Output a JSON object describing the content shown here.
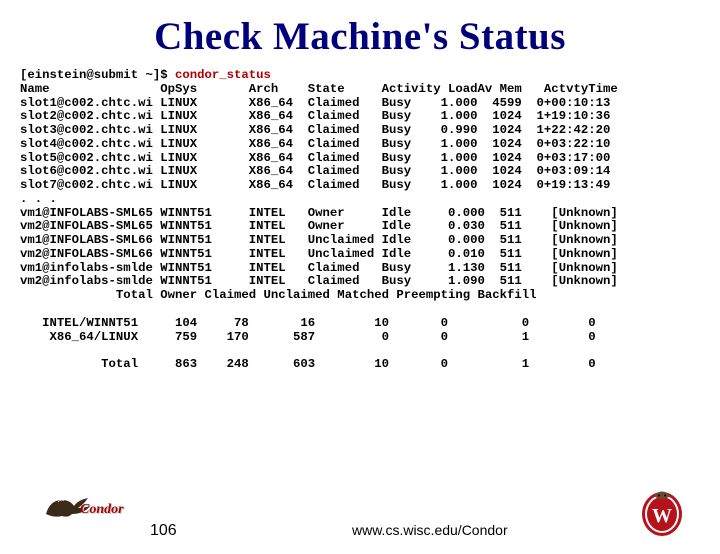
{
  "title": "Check Machine's Status",
  "prompt": "[einstein@submit ~]$ ",
  "command": "condor_status",
  "headers": {
    "name": "Name",
    "opsys": "OpSys",
    "arch": "Arch",
    "state": "State",
    "activity": "Activity",
    "loadav": "LoadAv",
    "mem": "Mem",
    "actvtytime": "ActvtyTime"
  },
  "rows1": [
    {
      "name": "slot1@c002.chtc.wi",
      "op": "LINUX",
      "arch": "X86_64",
      "state": "Claimed",
      "act": "Busy",
      "load": "1.000",
      "mem": "4599",
      "time": "0+00:10:13"
    },
    {
      "name": "slot2@c002.chtc.wi",
      "op": "LINUX",
      "arch": "X86_64",
      "state": "Claimed",
      "act": "Busy",
      "load": "1.000",
      "mem": "1024",
      "time": "1+19:10:36"
    },
    {
      "name": "slot3@c002.chtc.wi",
      "op": "LINUX",
      "arch": "X86_64",
      "state": "Claimed",
      "act": "Busy",
      "load": "0.990",
      "mem": "1024",
      "time": "1+22:42:20"
    },
    {
      "name": "slot4@c002.chtc.wi",
      "op": "LINUX",
      "arch": "X86_64",
      "state": "Claimed",
      "act": "Busy",
      "load": "1.000",
      "mem": "1024",
      "time": "0+03:22:10"
    },
    {
      "name": "slot5@c002.chtc.wi",
      "op": "LINUX",
      "arch": "X86_64",
      "state": "Claimed",
      "act": "Busy",
      "load": "1.000",
      "mem": "1024",
      "time": "0+03:17:00"
    },
    {
      "name": "slot6@c002.chtc.wi",
      "op": "LINUX",
      "arch": "X86_64",
      "state": "Claimed",
      "act": "Busy",
      "load": "1.000",
      "mem": "1024",
      "time": "0+03:09:14"
    },
    {
      "name": "slot7@c002.chtc.wi",
      "op": "LINUX",
      "arch": "X86_64",
      "state": "Claimed",
      "act": "Busy",
      "load": "1.000",
      "mem": "1024",
      "time": "0+19:13:49"
    }
  ],
  "ellipsis": ". . .",
  "rows2": [
    {
      "name": "vm1@INFOLABS-SML65",
      "op": "WINNT51",
      "arch": "INTEL",
      "state": "Owner",
      "act": "Idle",
      "load": "0.000",
      "mem": "511",
      "time": "[Unknown]"
    },
    {
      "name": "vm2@INFOLABS-SML65",
      "op": "WINNT51",
      "arch": "INTEL",
      "state": "Owner",
      "act": "Idle",
      "load": "0.030",
      "mem": "511",
      "time": "[Unknown]"
    },
    {
      "name": "vm1@INFOLABS-SML66",
      "op": "WINNT51",
      "arch": "INTEL",
      "state": "Unclaimed",
      "act": "Idle",
      "load": "0.000",
      "mem": "511",
      "time": "[Unknown]"
    },
    {
      "name": "vm2@INFOLABS-SML66",
      "op": "WINNT51",
      "arch": "INTEL",
      "state": "Unclaimed",
      "act": "Idle",
      "load": "0.010",
      "mem": "511",
      "time": "[Unknown]"
    },
    {
      "name": "vm1@infolabs-smlde",
      "op": "WINNT51",
      "arch": "INTEL",
      "state": "Claimed",
      "act": "Busy",
      "load": "1.130",
      "mem": "511",
      "time": "[Unknown]"
    },
    {
      "name": "vm2@infolabs-smlde",
      "op": "WINNT51",
      "arch": "INTEL",
      "state": "Claimed",
      "act": "Busy",
      "load": "1.090",
      "mem": "511",
      "time": "[Unknown]"
    }
  ],
  "summary_header": "             Total Owner Claimed Unclaimed Matched Preempting Backfill",
  "summary": [
    {
      "label": "INTEL/WINNT51",
      "total": "104",
      "owner": "78",
      "claimed": "16",
      "unclaimed": "10",
      "matched": "0",
      "preempting": "0",
      "backfill": "0"
    },
    {
      "label": "X86_64/LINUX",
      "total": "759",
      "owner": "170",
      "claimed": "587",
      "unclaimed": "0",
      "matched": "0",
      "preempting": "1",
      "backfill": "0"
    }
  ],
  "grand": {
    "label": "Total",
    "total": "863",
    "owner": "248",
    "claimed": "603",
    "unclaimed": "10",
    "matched": "0",
    "preempting": "1",
    "backfill": "0"
  },
  "footer": {
    "page": "106",
    "url": "www.cs.wisc.edu/Condor",
    "condor_label": "Condor"
  }
}
